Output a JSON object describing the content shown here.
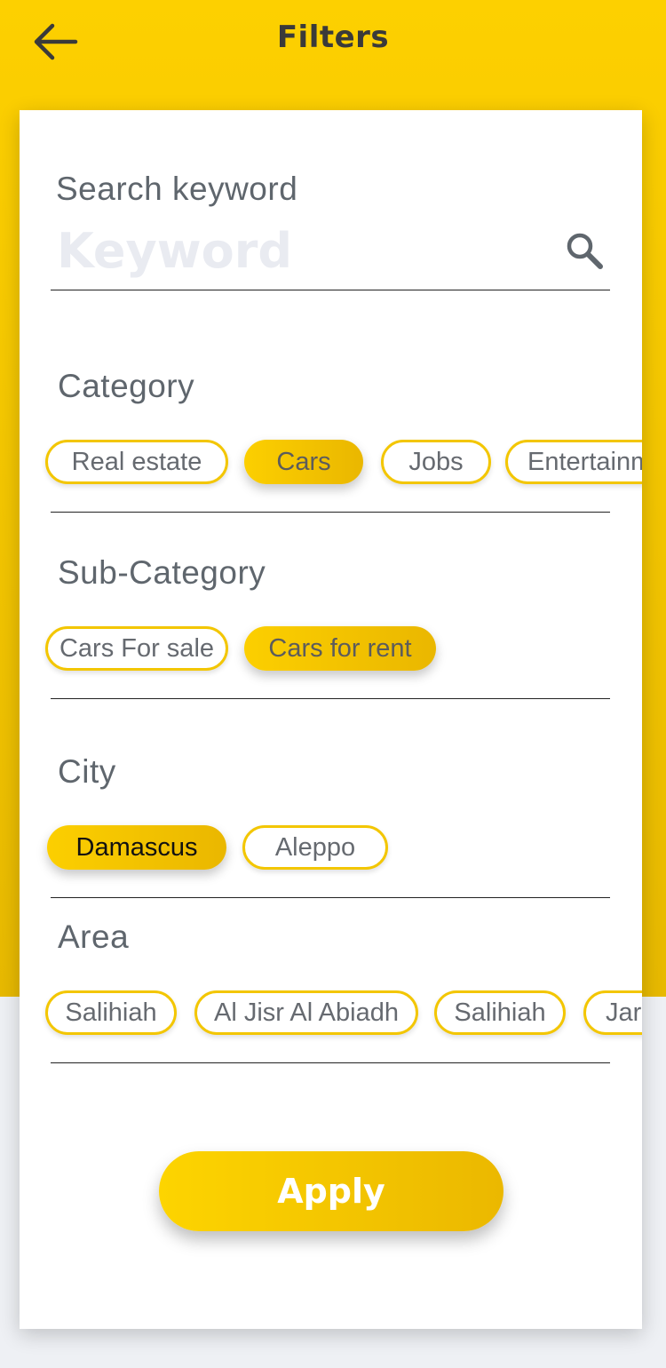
{
  "header": {
    "title": "Filters",
    "back_icon": "arrow-left-icon"
  },
  "search": {
    "label": "Search keyword",
    "placeholder": "Keyword",
    "value": "",
    "icon": "search-icon"
  },
  "category": {
    "label": "Category",
    "chips": [
      {
        "label": "Real estate",
        "selected": false
      },
      {
        "label": "Cars",
        "selected": true
      },
      {
        "label": "Jobs",
        "selected": false
      },
      {
        "label": "Entertainm",
        "selected": false
      }
    ]
  },
  "subcategory": {
    "label": "Sub-Category",
    "chips": [
      {
        "label": "Cars For sale",
        "selected": false
      },
      {
        "label": "Cars for rent",
        "selected": true
      }
    ]
  },
  "city": {
    "label": "City",
    "chips": [
      {
        "label": "Damascus",
        "selected": true
      },
      {
        "label": "Aleppo",
        "selected": false
      }
    ]
  },
  "area": {
    "label": "Area",
    "chips": [
      {
        "label": "Salihiah",
        "selected": false
      },
      {
        "label": "Al Jisr Al Abiadh",
        "selected": false
      },
      {
        "label": "Salihiah",
        "selected": false
      },
      {
        "label": "Jar",
        "selected": false
      }
    ]
  },
  "apply": {
    "label": "Apply"
  },
  "colors": {
    "accent": "#f3c600",
    "accent_dark": "#e7b900",
    "card": "#ffffff",
    "text": "#5f666d"
  }
}
